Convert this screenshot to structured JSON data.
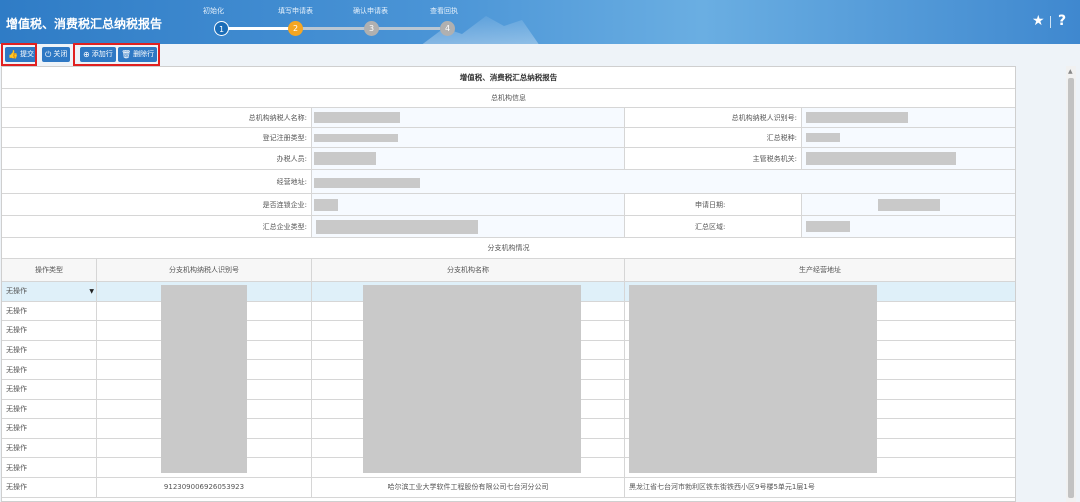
{
  "header": {
    "title": "增值税、消费税汇总纳税报告",
    "steps": [
      {
        "num": "1",
        "label": "初始化"
      },
      {
        "num": "2",
        "label": "填写申请表"
      },
      {
        "num": "3",
        "label": "确认申请表"
      },
      {
        "num": "4",
        "label": "查看回执"
      }
    ],
    "icons": [
      "star-icon",
      "help-icon"
    ],
    "star_glyph": "★",
    "help_glyph": "?"
  },
  "toolbar": {
    "submit": "提交",
    "close": "关闭",
    "add_row": "添加行",
    "delete_row": "删除行"
  },
  "form": {
    "title": "增值税、消费税汇总纳税报告",
    "head_section": "总机构信息",
    "labels": {
      "head_name": "总机构纳税人名称:",
      "head_id": "总机构纳税人识别号:",
      "reg_type": "登记注册类型:",
      "tax_type": "汇总税种:",
      "handler": "办税人员:",
      "authority": "主管税务机关:",
      "address": "经营地址:",
      "is_chain": "是否连锁企业:",
      "apply_date": "申请日期:",
      "company_type": "汇总企业类型:",
      "area": "汇总区域:"
    },
    "branch_section": "分支机构情况",
    "columns": [
      "操作类型",
      "分支机构纳税人识别号",
      "分支机构名称",
      "生产经营地址"
    ],
    "op_default": "无操作",
    "rows": [
      {
        "op": "无操作",
        "id": "",
        "name": "",
        "addr": ""
      },
      {
        "op": "无操作",
        "id": "",
        "name": "",
        "addr": ""
      },
      {
        "op": "无操作",
        "id": "",
        "name": "",
        "addr": ""
      },
      {
        "op": "无操作",
        "id": "",
        "name": "",
        "addr": ""
      },
      {
        "op": "无操作",
        "id": "",
        "name": "",
        "addr": ""
      },
      {
        "op": "无操作",
        "id": "",
        "name": "",
        "addr": ""
      },
      {
        "op": "无操作",
        "id": "",
        "name": "",
        "addr": ""
      },
      {
        "op": "无操作",
        "id": "",
        "name": "",
        "addr": ""
      },
      {
        "op": "无操作",
        "id": "",
        "name": "",
        "addr": ""
      },
      {
        "op": "无操作",
        "id": "",
        "name": "",
        "addr": ""
      },
      {
        "op": "无操作",
        "id": "912309006926053923",
        "name": "哈尔滨工业大学软件工程股份有限公司七台河分公司",
        "addr": "黑龙江省七台河市勃利区铁东街铁西小区9号楼5单元1层1号"
      }
    ]
  }
}
